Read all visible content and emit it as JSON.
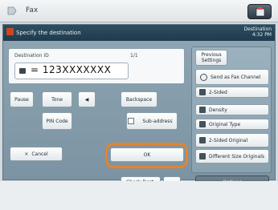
{
  "header": {
    "title": "Fax"
  },
  "window": {
    "title": "Specify the destination",
    "status_line1": "Destination",
    "status_line2": "4:32 PM"
  },
  "destination": {
    "label": "Destination ID",
    "number_label": "1/1",
    "value": "= 123XXXXXXX"
  },
  "buttons": {
    "pause": "Pause",
    "tone": "Tone",
    "left_arrow": "◀",
    "backspace": "Backspace",
    "pin_code": "PIN Code",
    "subaddress": "Sub-address",
    "cancel": "Cancel",
    "ok": "OK",
    "check_dest": "Check Dest."
  },
  "side": {
    "options_label": "Previous Settings",
    "items": [
      "Send as Fax Channel",
      "2-Sided",
      "Density",
      "Original Type",
      "2-Sided Original",
      "Different Size Originals"
    ],
    "options_button": "Options"
  }
}
